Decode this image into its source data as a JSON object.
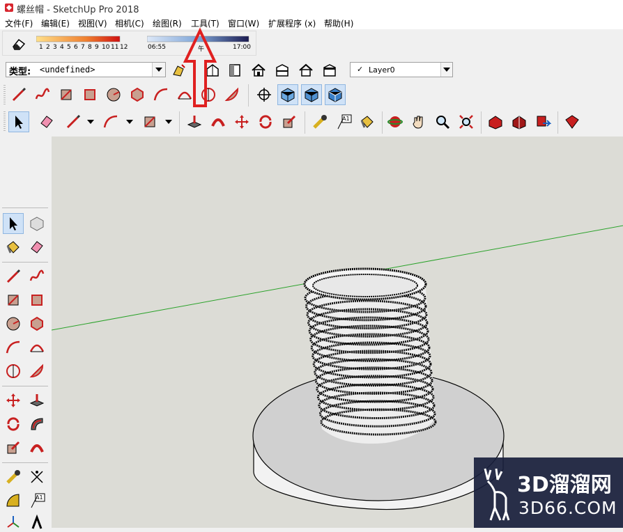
{
  "window": {
    "title": "螺丝帽 - SketchUp Pro 2018"
  },
  "menu": [
    {
      "label": "文件(F)"
    },
    {
      "label": "编辑(E)"
    },
    {
      "label": "视图(V)"
    },
    {
      "label": "相机(C)"
    },
    {
      "label": "绘图(R)"
    },
    {
      "label": "工具(T)"
    },
    {
      "label": "窗口(W)"
    },
    {
      "label": "扩展程序 (x)"
    },
    {
      "label": "帮助(H)"
    }
  ],
  "shadow": {
    "scale": [
      "1",
      "2",
      "3",
      "4",
      "5",
      "6",
      "7",
      "8",
      "9",
      "10",
      "11",
      "12"
    ],
    "time_start": "06:55",
    "time_mid": "午",
    "time_end": "17:00"
  },
  "entity": {
    "type_label": "类型:",
    "type_value": "<undefined>"
  },
  "layer": {
    "check": "✓",
    "name": "Layer0"
  },
  "tools": {
    "left_a1_text": "A1",
    "top_a1_text": "A1"
  },
  "watermark": {
    "main": "3D溜溜网",
    "sub": "3D66.COM"
  },
  "colors": {
    "accent_red": "#e02020",
    "select_blue": "#cfe2f7",
    "axis_green": "#2aa22a"
  }
}
